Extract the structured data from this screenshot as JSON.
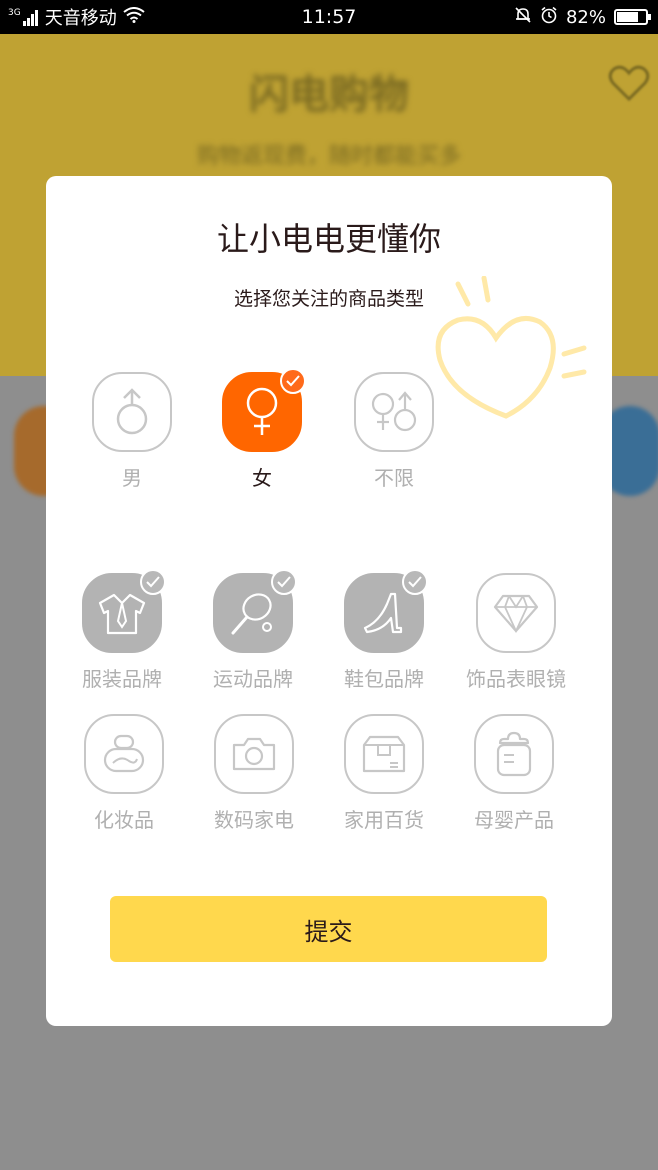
{
  "status_bar": {
    "network": "3G",
    "carrier": "天音移动",
    "time": "11:57",
    "battery": "82%",
    "battery_level": 0.82
  },
  "background": {
    "title": "闪电购物",
    "subtitle": "购物返现费，随时都能买多"
  },
  "dialog": {
    "title": "让小电电更懂你",
    "subtitle": "选择您关注的商品类型",
    "gender_options": [
      {
        "label": "男",
        "selected": false,
        "icon": "male-icon"
      },
      {
        "label": "女",
        "selected": true,
        "icon": "female-icon"
      },
      {
        "label": "不限",
        "selected": false,
        "icon": "gender-any-icon"
      }
    ],
    "category_options": [
      {
        "label": "服装品牌",
        "selected": true,
        "icon": "clothing-icon"
      },
      {
        "label": "运动品牌",
        "selected": true,
        "icon": "racket-icon"
      },
      {
        "label": "鞋包品牌",
        "selected": true,
        "icon": "high-heel-icon"
      },
      {
        "label": "饰品表眼镜",
        "selected": false,
        "icon": "diamond-icon"
      },
      {
        "label": "化妆品",
        "selected": false,
        "icon": "cosmetics-icon"
      },
      {
        "label": "数码家电",
        "selected": false,
        "icon": "camera-icon"
      },
      {
        "label": "家用百货",
        "selected": false,
        "icon": "package-icon"
      },
      {
        "label": "母婴产品",
        "selected": false,
        "icon": "baby-bottle-icon"
      }
    ],
    "submit_label": "提交"
  },
  "colors": {
    "accent_orange": "#ff6600",
    "button_yellow": "#ffd84d",
    "selected_gray": "#b3b3b3"
  }
}
